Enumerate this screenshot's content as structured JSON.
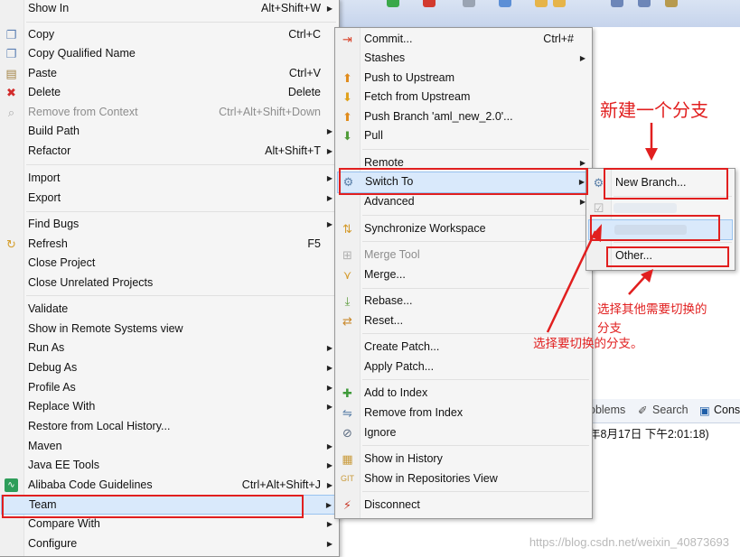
{
  "background": {
    "views_tabs": [
      "oblems",
      "Search",
      "Cons"
    ],
    "console_line": "年8月17日 下午2:01:18)"
  },
  "menu1": {
    "items": [
      {
        "label": "Show In",
        "shortcut": "Alt+Shift+W",
        "icon": ""
      },
      {
        "label": "Copy",
        "shortcut": "Ctrl+C",
        "icon": "copy-icon"
      },
      {
        "label": "Copy Qualified Name",
        "shortcut": "",
        "icon": "copy-qualified-icon"
      },
      {
        "label": "Paste",
        "shortcut": "Ctrl+V",
        "icon": "paste-icon"
      },
      {
        "label": "Delete",
        "shortcut": "Delete",
        "icon": "delete-icon"
      },
      {
        "label": "Remove from Context",
        "shortcut": "Ctrl+Alt+Shift+Down",
        "icon": "remove-context-icon"
      },
      {
        "label": "Build Path",
        "shortcut": "",
        "icon": ""
      },
      {
        "label": "Refactor",
        "shortcut": "Alt+Shift+T",
        "icon": ""
      },
      {
        "label": "Import",
        "shortcut": "",
        "icon": ""
      },
      {
        "label": "Export",
        "shortcut": "",
        "icon": ""
      },
      {
        "label": "Find Bugs",
        "shortcut": "",
        "icon": ""
      },
      {
        "label": "Refresh",
        "shortcut": "F5",
        "icon": "refresh-icon"
      },
      {
        "label": "Close Project",
        "shortcut": "",
        "icon": ""
      },
      {
        "label": "Close Unrelated Projects",
        "shortcut": "",
        "icon": ""
      },
      {
        "label": "Validate",
        "shortcut": "",
        "icon": ""
      },
      {
        "label": "Show in Remote Systems view",
        "shortcut": "",
        "icon": ""
      },
      {
        "label": "Run As",
        "shortcut": "",
        "icon": ""
      },
      {
        "label": "Debug As",
        "shortcut": "",
        "icon": ""
      },
      {
        "label": "Profile As",
        "shortcut": "",
        "icon": ""
      },
      {
        "label": "Replace With",
        "shortcut": "",
        "icon": ""
      },
      {
        "label": "Restore from Local History...",
        "shortcut": "",
        "icon": ""
      },
      {
        "label": "Maven",
        "shortcut": "",
        "icon": ""
      },
      {
        "label": "Java EE Tools",
        "shortcut": "",
        "icon": ""
      },
      {
        "label": "Alibaba Code Guidelines",
        "shortcut": "Ctrl+Alt+Shift+J",
        "icon": "alibaba-icon"
      },
      {
        "label": "Team",
        "shortcut": "",
        "icon": ""
      },
      {
        "label": "Compare With",
        "shortcut": "",
        "icon": ""
      },
      {
        "label": "Configure",
        "shortcut": "",
        "icon": ""
      }
    ]
  },
  "menu2": {
    "items": [
      {
        "label": "Commit...",
        "shortcut": "Ctrl+#",
        "icon": "commit-icon"
      },
      {
        "label": "Stashes",
        "shortcut": "",
        "icon": ""
      },
      {
        "label": "Push to Upstream",
        "shortcut": "",
        "icon": "push-upstream-icon"
      },
      {
        "label": "Fetch from Upstream",
        "shortcut": "",
        "icon": "fetch-upstream-icon"
      },
      {
        "label": "Push Branch 'aml_new_2.0'...",
        "shortcut": "",
        "icon": "push-branch-icon"
      },
      {
        "label": "Pull",
        "shortcut": "",
        "icon": "pull-icon"
      },
      {
        "label": "Remote",
        "shortcut": "",
        "icon": ""
      },
      {
        "label": "Switch To",
        "shortcut": "",
        "icon": "switch-to-icon"
      },
      {
        "label": "Advanced",
        "shortcut": "",
        "icon": ""
      },
      {
        "label": "Synchronize Workspace",
        "shortcut": "",
        "icon": "synchronize-icon"
      },
      {
        "label": "Merge Tool",
        "shortcut": "",
        "icon": "merge-tool-icon"
      },
      {
        "label": "Merge...",
        "shortcut": "",
        "icon": "merge-icon"
      },
      {
        "label": "Rebase...",
        "shortcut": "",
        "icon": "rebase-icon"
      },
      {
        "label": "Reset...",
        "shortcut": "",
        "icon": "reset-icon"
      },
      {
        "label": "Create Patch...",
        "shortcut": "",
        "icon": ""
      },
      {
        "label": "Apply Patch...",
        "shortcut": "",
        "icon": ""
      },
      {
        "label": "Add to Index",
        "shortcut": "",
        "icon": "add-index-icon"
      },
      {
        "label": "Remove from Index",
        "shortcut": "",
        "icon": "remove-index-icon"
      },
      {
        "label": "Ignore",
        "shortcut": "",
        "icon": "ignore-icon"
      },
      {
        "label": "Show in History",
        "shortcut": "",
        "icon": "history-icon"
      },
      {
        "label": "Show in Repositories View",
        "shortcut": "",
        "icon": "repositories-icon"
      },
      {
        "label": "Disconnect",
        "shortcut": "",
        "icon": "disconnect-icon"
      }
    ]
  },
  "menu3": {
    "items": [
      {
        "label": "New Branch...",
        "icon": "new-branch-icon"
      },
      {
        "label": "Other...",
        "icon": ""
      }
    ]
  },
  "annotations": {
    "new_branch": "新建一个分支",
    "select_branch": "选择要切换的分支。",
    "select_other_line1": "选择其他需要切换的",
    "select_other_line2": "分支"
  },
  "watermark": "https://blog.csdn.net/weixin_40873693",
  "colors": {
    "annotation_red": "#e11f1f",
    "highlight": "#d9e9fb",
    "menu_bg": "#f5f5f5"
  }
}
